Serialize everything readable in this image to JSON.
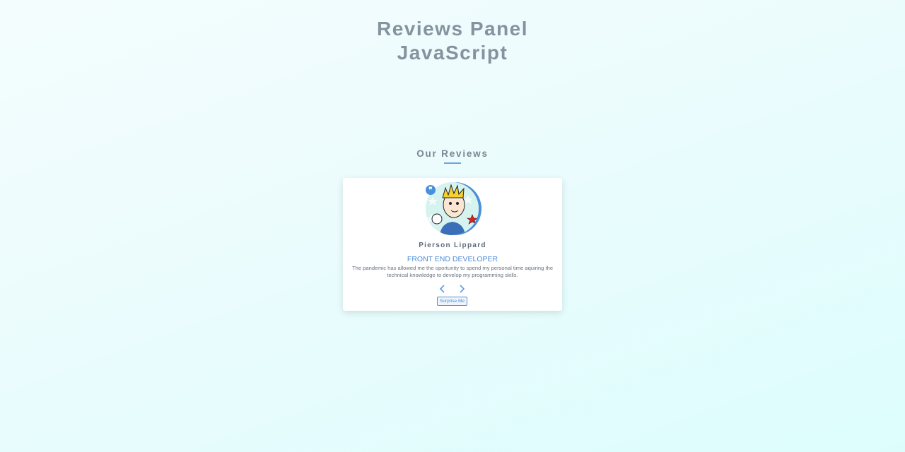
{
  "header": {
    "title_line1": "Reviews Panel",
    "title_line2": "JavaScript"
  },
  "section": {
    "title": "Our Reviews"
  },
  "review": {
    "author": "Pierson Lippard",
    "job": "Front End Developer",
    "info": "The pandemic has allowed me the oportunity to spend my personal time aquiring the technical knowledge to develop my programming skills.",
    "quote_icon": "quote-icon",
    "avatar": "cartoon-avatar"
  },
  "controls": {
    "prev_icon": "chevron-left-icon",
    "next_icon": "chevron-right-icon",
    "surprise_label": "Surprise Me"
  },
  "colors": {
    "accent": "#4a90d9",
    "title": "#8593a0",
    "job": "#4f8cd6"
  }
}
